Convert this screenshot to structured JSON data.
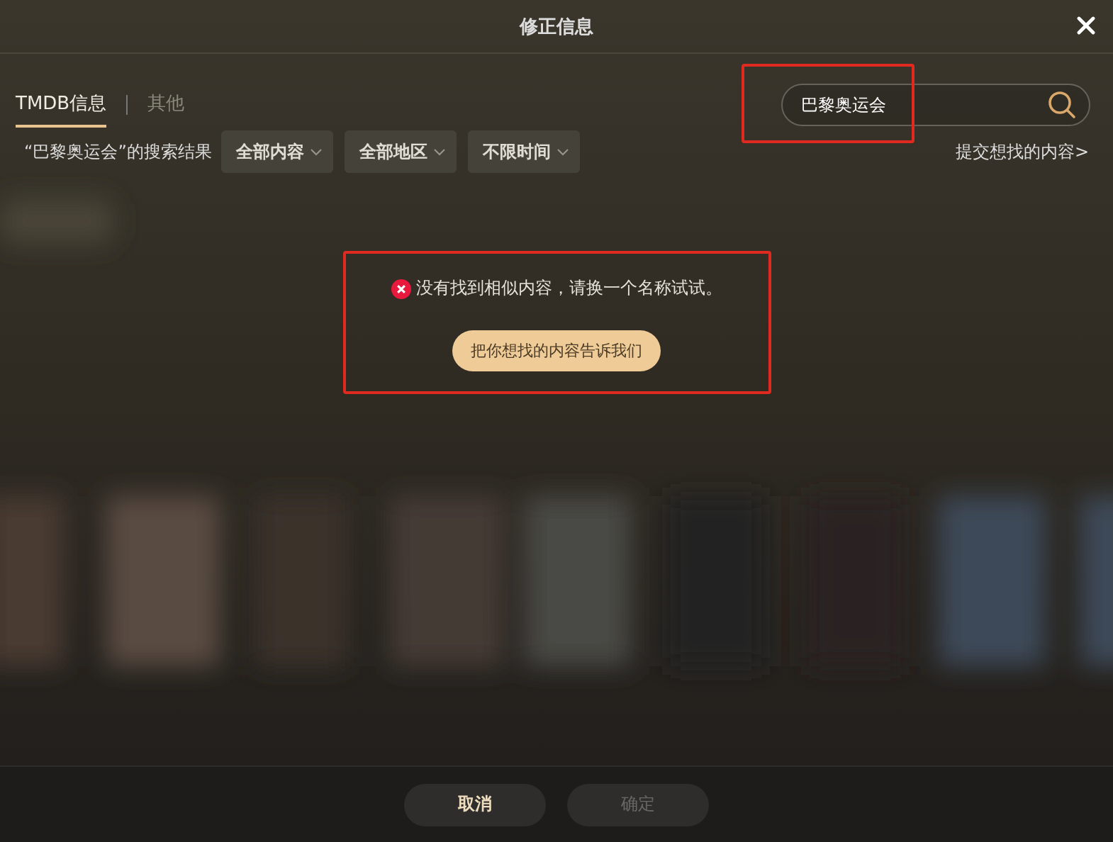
{
  "window": {
    "title": "修正信息"
  },
  "tabs": [
    {
      "label": "TMDB信息",
      "selected": true
    },
    {
      "label": "其他",
      "selected": false
    }
  ],
  "search": {
    "value": "巴黎奥运会"
  },
  "filters": {
    "result_label": "“巴黎奥运会”的搜索结果",
    "dropdowns": [
      "全部内容",
      "全部地区",
      "不限时间"
    ],
    "submit_link": "提交想找的内容>"
  },
  "message": {
    "text": "没有找到相似内容，请换一个名称试试。",
    "button": "把你想找的内容告诉我们"
  },
  "footer_buttons": [
    {
      "label": "取消",
      "disabled": false
    },
    {
      "label": "确定",
      "disabled": true
    }
  ]
}
